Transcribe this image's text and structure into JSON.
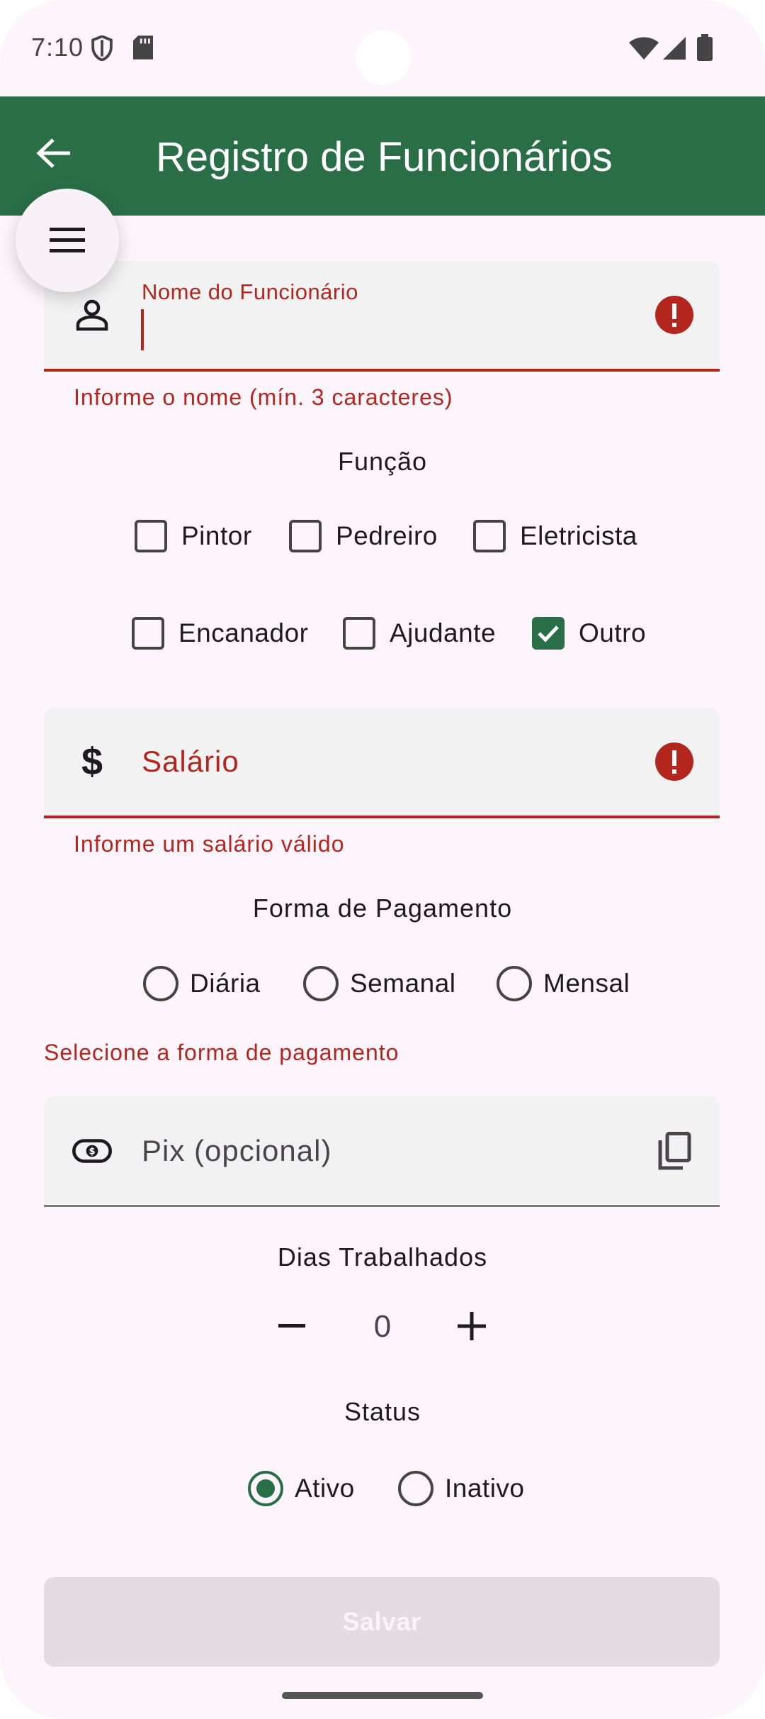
{
  "status_bar": {
    "time": "7:10"
  },
  "app_bar": {
    "title": "Registro de Funcionários"
  },
  "name_field": {
    "label": "Nome do Funcionário",
    "value": "",
    "error": "Informe o nome (mín. 3 caracteres)"
  },
  "role_section": {
    "title": "Função",
    "options": [
      {
        "label": "Pintor",
        "checked": false
      },
      {
        "label": "Pedreiro",
        "checked": false
      },
      {
        "label": "Eletricista",
        "checked": false
      },
      {
        "label": "Encanador",
        "checked": false
      },
      {
        "label": "Ajudante",
        "checked": false
      },
      {
        "label": "Outro",
        "checked": true
      }
    ]
  },
  "salary_field": {
    "label": "Salário",
    "error": "Informe um salário válido"
  },
  "payment_section": {
    "title": "Forma de Pagamento",
    "options": [
      {
        "label": "Diária",
        "selected": false
      },
      {
        "label": "Semanal",
        "selected": false
      },
      {
        "label": "Mensal",
        "selected": false
      }
    ],
    "error": "Selecione a forma de pagamento"
  },
  "pix_field": {
    "placeholder": "Pix (opcional)"
  },
  "days_section": {
    "title": "Dias Trabalhados",
    "value": "0"
  },
  "status_section": {
    "title": "Status",
    "options": [
      {
        "label": "Ativo",
        "selected": true
      },
      {
        "label": "Inativo",
        "selected": false
      }
    ]
  },
  "save_button": {
    "label": "Salvar"
  },
  "colors": {
    "primary": "#2a6e47",
    "error": "#b3261e",
    "background": "#fdf4fc",
    "field_bg": "#f2f2f2"
  }
}
